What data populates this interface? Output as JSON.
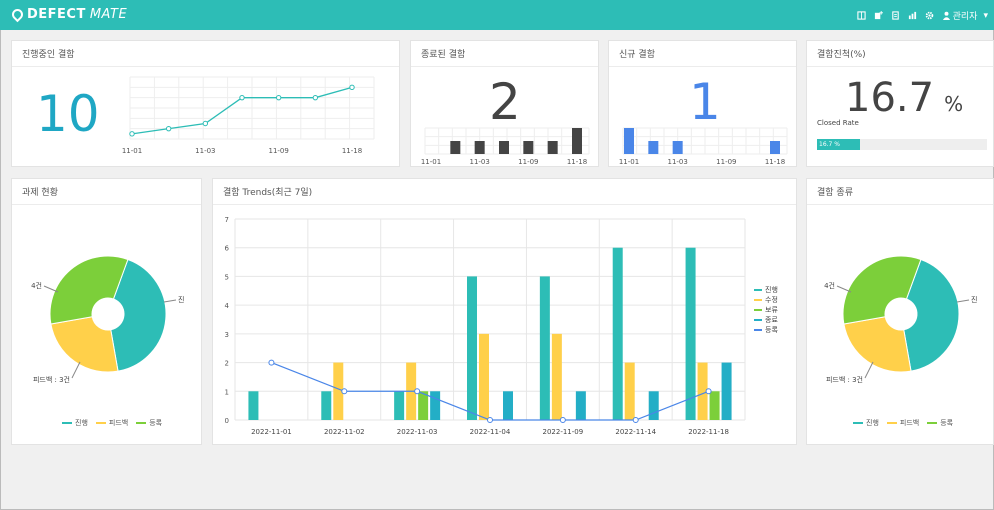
{
  "app": {
    "logo_a": "DEFECT",
    "logo_b": "MATE",
    "user": "관리자"
  },
  "topbar_icons": [
    "book-icon",
    "add-list-icon",
    "document-icon",
    "chart-icon",
    "gear-icon"
  ],
  "cards": {
    "in_progress": {
      "title": "진행중인 결함",
      "value": "10",
      "color": "#1fa7c4"
    },
    "closed": {
      "title": "종료된 결함",
      "value": "2"
    },
    "new": {
      "title": "신규 결함",
      "value": "1",
      "color": "#4a86e8"
    },
    "rate": {
      "title": "결함진척(%)",
      "value": "16.7",
      "unit": "%",
      "sub": "Closed Rate",
      "bar_label": "16.7 %",
      "bar_fraction": 0.167
    },
    "tasks": {
      "title": "과제 현황"
    },
    "trends": {
      "title": "결함 Trends(최근 7일)"
    },
    "types": {
      "title": "결함 종류"
    }
  },
  "spark_in_progress": {
    "x": [
      "11-01",
      "11-02",
      "11-03",
      "11-04",
      "11-09",
      "11-14",
      "11-18"
    ],
    "y": [
      1,
      2,
      3,
      8,
      8,
      8,
      10
    ],
    "labels": [
      "11-01",
      "11-03",
      "11-09",
      "11-18"
    ],
    "ylim": [
      0,
      12
    ]
  },
  "spark_closed": {
    "x": [
      "11-01",
      "11-02",
      "11-03",
      "11-04",
      "11-09",
      "11-14",
      "11-18"
    ],
    "y": [
      0,
      1,
      1,
      1,
      1,
      1,
      2
    ],
    "labels": [
      "11-01",
      "11-03",
      "11-09",
      "11-18"
    ],
    "color": "#444444"
  },
  "spark_new": {
    "x": [
      "11-01",
      "11-02",
      "11-03",
      "11-04",
      "11-09",
      "11-14",
      "11-18"
    ],
    "y": [
      2,
      1,
      1,
      0,
      0,
      0,
      1
    ],
    "labels": [
      "11-01",
      "11-03",
      "11-09",
      "11-18"
    ],
    "color": "#4a86e8"
  },
  "pie_tasks": {
    "slices": [
      {
        "name": "진행",
        "value": 5,
        "color": "#2dbdb6"
      },
      {
        "name": "피드백",
        "value": 3,
        "color": "#ffd04a"
      },
      {
        "name": "등록",
        "value": 4,
        "color": "#7ccf3a"
      }
    ],
    "labels": {
      "left": "4건",
      "bottom": "피드백 : 3건",
      "right": "진"
    }
  },
  "pie_types": {
    "slices": [
      {
        "name": "진행",
        "value": 5,
        "color": "#2dbdb6"
      },
      {
        "name": "피드백",
        "value": 3,
        "color": "#ffd04a"
      },
      {
        "name": "등록",
        "value": 4,
        "color": "#7ccf3a"
      }
    ],
    "labels": {
      "left": "4건",
      "bottom": "피드백 : 3건",
      "right": "진"
    }
  },
  "chart_data": {
    "type": "bar",
    "categories": [
      "2022-11-01",
      "2022-11-02",
      "2022-11-03",
      "2022-11-04",
      "2022-11-09",
      "2022-11-14",
      "2022-11-18"
    ],
    "ylim": [
      0,
      7
    ],
    "yticks": [
      0,
      1,
      2,
      3,
      4,
      5,
      6,
      7
    ],
    "series": [
      {
        "name": "진행",
        "type": "bar",
        "color": "#2dbdb6",
        "values": [
          1,
          1,
          1,
          5,
          5,
          6,
          6
        ]
      },
      {
        "name": "수정",
        "type": "bar",
        "color": "#ffd04a",
        "values": [
          0,
          2,
          2,
          3,
          3,
          2,
          2
        ]
      },
      {
        "name": "보류",
        "type": "bar",
        "color": "#7ccf3a",
        "values": [
          0,
          0,
          1,
          0,
          0,
          0,
          1
        ]
      },
      {
        "name": "종료",
        "type": "bar",
        "color": "#23aec6",
        "values": [
          0,
          0,
          1,
          1,
          1,
          1,
          2
        ]
      },
      {
        "name": "등록",
        "type": "line",
        "color": "#4a86e8",
        "values": [
          2,
          1,
          1,
          0,
          0,
          0,
          1
        ]
      }
    ]
  }
}
